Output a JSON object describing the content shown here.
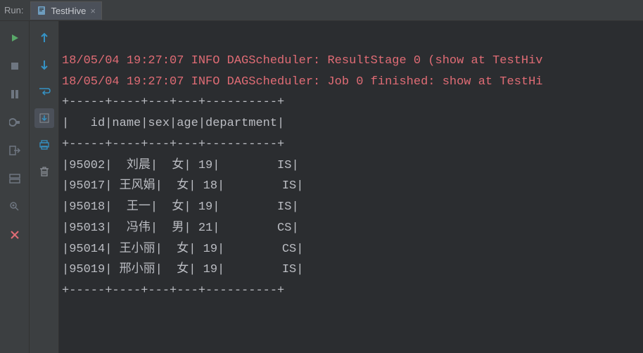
{
  "header": {
    "run_label": "Run:",
    "tab_name": "TestHive"
  },
  "log_lines": [
    "18/05/04 19:27:07 INFO DAGScheduler: ResultStage 0 (show at TestHiv",
    "18/05/04 19:27:07 INFO DAGScheduler: Job 0 finished: show at TestHi"
  ],
  "table": {
    "border": "+-----+----+---+---+----------+",
    "header": "|   id|name|sex|age|department|",
    "rows": [
      {
        "id": "95002",
        "name": "刘晨",
        "sex": "女",
        "age": "19",
        "department": "IS"
      },
      {
        "id": "95017",
        "name": "王风娟",
        "sex": "女",
        "age": "18",
        "department": "IS"
      },
      {
        "id": "95018",
        "name": "王一",
        "sex": "女",
        "age": "19",
        "department": "IS"
      },
      {
        "id": "95013",
        "name": "冯伟",
        "sex": "男",
        "age": "21",
        "department": "CS"
      },
      {
        "id": "95014",
        "name": "王小丽",
        "sex": "女",
        "age": "19",
        "department": "CS"
      },
      {
        "id": "95019",
        "name": "邢小丽",
        "sex": "女",
        "age": "19",
        "department": "IS"
      }
    ]
  },
  "colors": {
    "log_info": "#e06c75",
    "background": "#2b2d30",
    "panel": "#3c3f41",
    "text": "#bcbec4"
  }
}
